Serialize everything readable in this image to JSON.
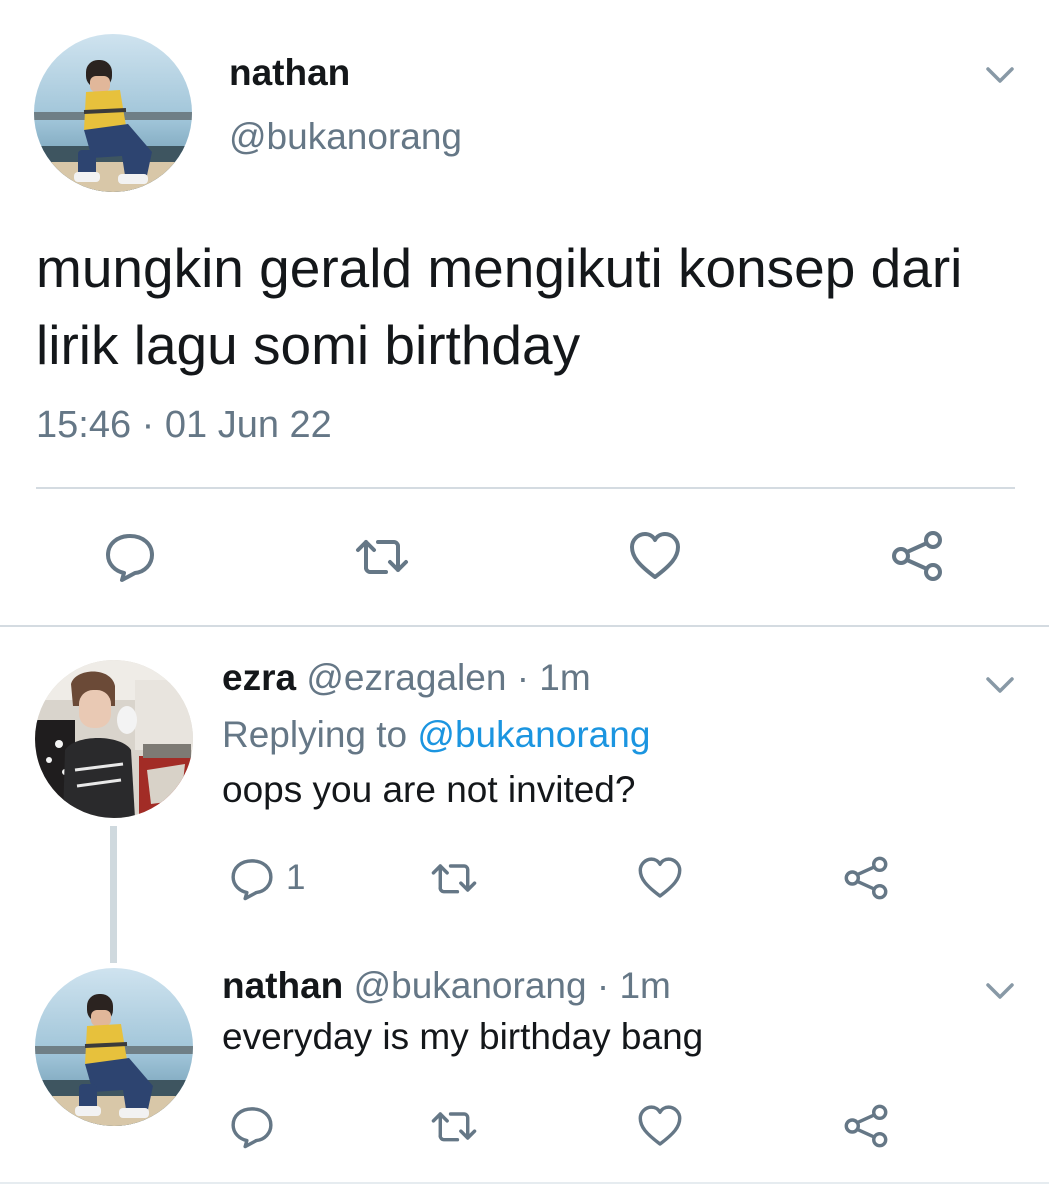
{
  "colors": {
    "text": "#14171a",
    "secondary": "#657786",
    "link": "#1b95e0",
    "divider": "#d4dbe1"
  },
  "main_tweet": {
    "author_name": "nathan",
    "author_handle": "@bukanorang",
    "text": "mungkin gerald mengikuti konsep dari lirik lagu somi birthday",
    "timestamp": "15:46 · 01 Jun 22",
    "actions": [
      "reply-icon",
      "retweet-icon",
      "like-icon",
      "share-icon"
    ],
    "menu_icon": "chevron-down-icon"
  },
  "replies": [
    {
      "author_name": "ezra",
      "author_handle": "@ezragalen",
      "meta": " · 1m",
      "replying_prefix": "Replying to ",
      "replying_to": "@bukanorang",
      "text": "oops you are not invited?",
      "reply_count": "1",
      "menu_icon": "chevron-down-icon"
    },
    {
      "author_name": "nathan",
      "author_handle": "@bukanorang",
      "meta": " · 1m",
      "text": "everyday is my birthday bang",
      "menu_icon": "chevron-down-icon"
    }
  ]
}
